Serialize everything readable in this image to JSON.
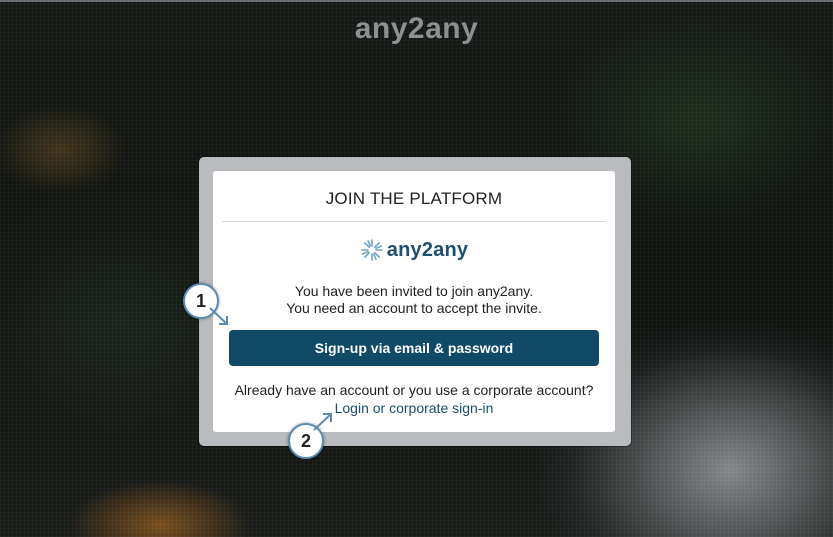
{
  "header": {
    "logo_text": "any2any"
  },
  "dialog": {
    "title": "JOIN THE PLATFORM",
    "brand_text": "any2any",
    "invite_line1": "You have been invited to join any2any.",
    "invite_line2": "You need an account to accept the invite.",
    "signup_button": "Sign-up via email & password",
    "already_text": "Already have an account or you use a corporate account?",
    "login_link": "Login or corporate sign-in"
  },
  "annotations": {
    "marker1": "1",
    "marker2": "2"
  },
  "colors": {
    "primary": "#104a66",
    "link": "#1a4d6b",
    "marker_border": "#5a8bb0"
  }
}
